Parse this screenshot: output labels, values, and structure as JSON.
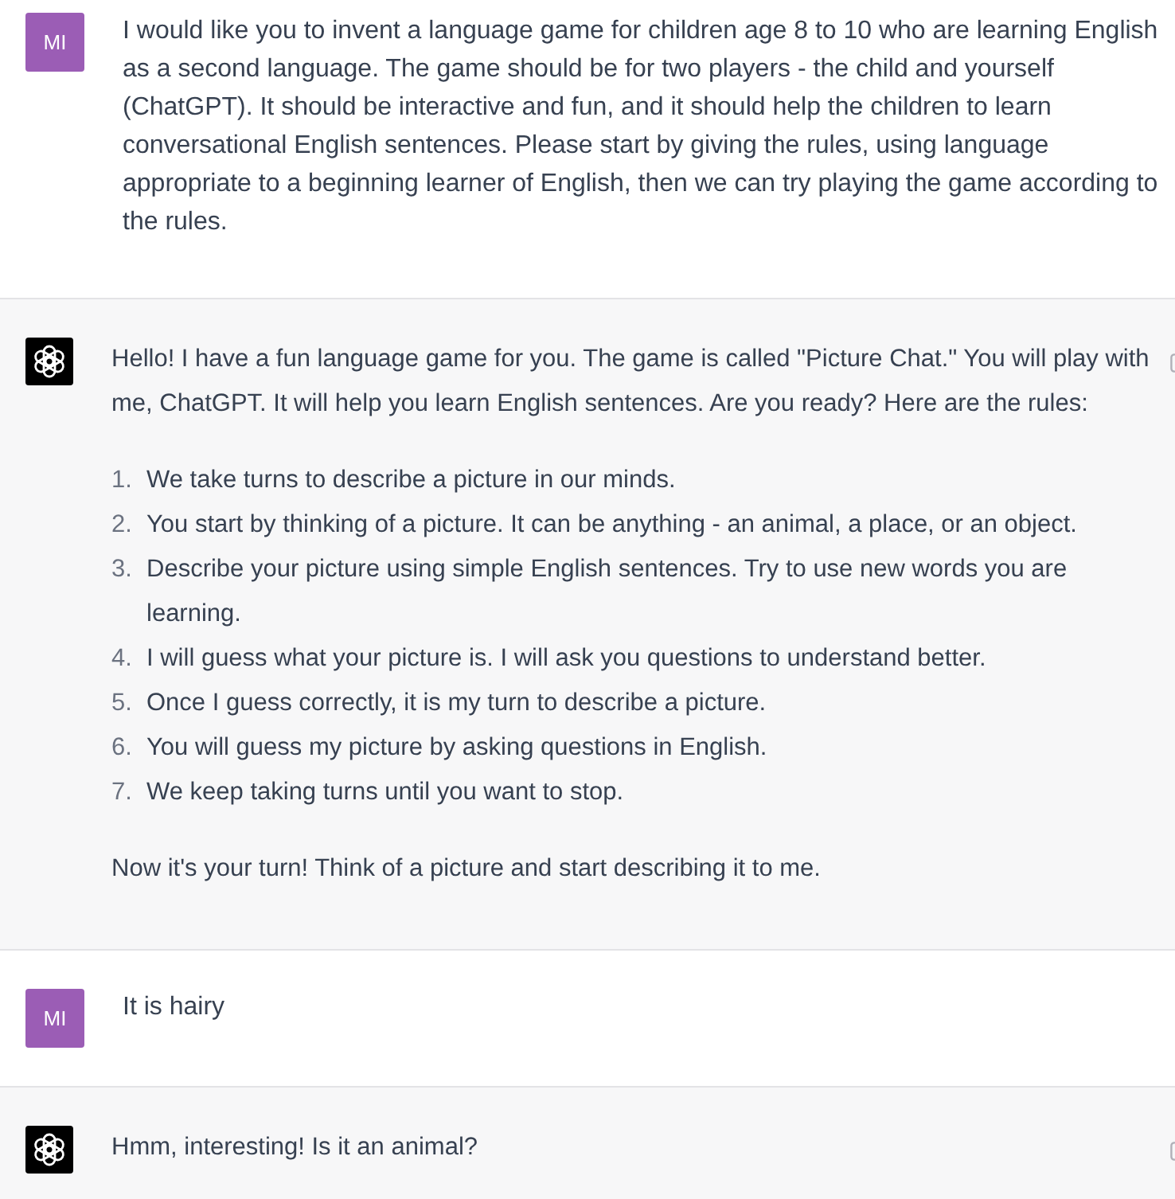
{
  "messages": [
    {
      "kind": "user",
      "avatar": "MI",
      "blocks": [
        {
          "kind": "paragraph",
          "text": "I would like you to invent a language game for children age 8 to 10 who are learning English as a second language. The game should be for two players - the child and yourself (ChatGPT). It should be interactive and fun, and it should help the children to learn conversational English sentences. Please start by giving the rules, using language appropriate to a beginning learner of English, then we can try playing the game according to the rules."
        }
      ]
    },
    {
      "kind": "assistant",
      "blocks": [
        {
          "kind": "paragraph",
          "text": "Hello! I have a fun language game for you. The game is called \"Picture Chat.\" You will play with me, ChatGPT. It will help you learn English sentences. Are you ready? Here are the rules:"
        },
        {
          "kind": "ordered_list",
          "items": [
            {
              "number": "1.",
              "text": "We take turns to describe a picture in our minds."
            },
            {
              "number": "2.",
              "text": "You start by thinking of a picture. It can be anything - an animal, a place, or an object."
            },
            {
              "number": "3.",
              "text": "Describe your picture using simple English sentences. Try to use new words you are learning."
            },
            {
              "number": "4.",
              "text": "I will guess what your picture is. I will ask you questions to understand better."
            },
            {
              "number": "5.",
              "text": "Once I guess correctly, it is my turn to describe a picture."
            },
            {
              "number": "6.",
              "text": "You will guess my picture by asking questions in English."
            },
            {
              "number": "7.",
              "text": "We keep taking turns until you want to stop."
            }
          ]
        },
        {
          "kind": "paragraph",
          "text": "Now it's your turn! Think of a picture and start describing it to me."
        }
      ]
    },
    {
      "kind": "user",
      "avatar": "MI",
      "blocks": [
        {
          "kind": "paragraph",
          "text": "It is hairy"
        }
      ]
    },
    {
      "kind": "assistant",
      "blocks": [
        {
          "kind": "paragraph",
          "text": "Hmm, interesting! Is it an animal?"
        }
      ]
    }
  ]
}
